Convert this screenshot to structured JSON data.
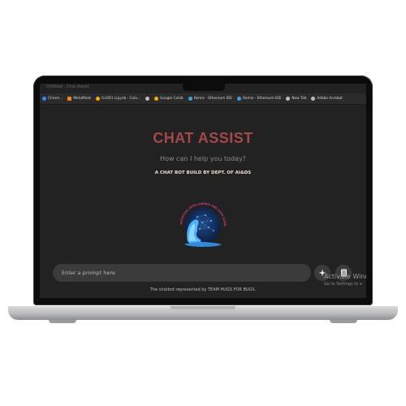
{
  "browser": {
    "window_title": "Untitled - Chat Assist",
    "bookmarks": [
      {
        "label": "Chrom...",
        "icon": "chrome-icon",
        "color": "#4285f4"
      },
      {
        "label": "MetaMask",
        "icon": "metamask-icon",
        "color": "#f6851b"
      },
      {
        "label": "fcc001 Lipynb - Cola...",
        "icon": "colab-icon",
        "color": "#f9ab00"
      },
      {
        "label": "",
        "icon": "globe-icon",
        "color": "#bdbdbd"
      },
      {
        "label": "Google Colab",
        "icon": "colab-icon",
        "color": "#f9ab00"
      },
      {
        "label": "Remix - Ethereum IDE",
        "icon": "remix-icon",
        "color": "#3aa3d9"
      },
      {
        "label": "Remix - Ethereum IDE",
        "icon": "remix-icon",
        "color": "#3aa3d9"
      },
      {
        "label": "New Tab",
        "icon": "globe-icon",
        "color": "#bdbdbd"
      },
      {
        "label": "Adobe Acrobat",
        "icon": "globe-icon",
        "color": "#bdbdbd"
      }
    ]
  },
  "chat": {
    "title": "CHAT ASSIST",
    "subtitle": "How can I help you today?",
    "tagline": "A CHAT BOT BUILD BY DEPT. OF AI&DS",
    "logo": {
      "ring_text": "ARTIFICIAL INTELLIGENCE AND DATA SCIENCE",
      "icon": "ai-head-logo-icon"
    },
    "prompt_placeholder": "Enter a prompt here",
    "buttons": [
      {
        "name": "image-upload-button",
        "icon": "sparkle-icon"
      },
      {
        "name": "document-button",
        "icon": "document-icon"
      }
    ],
    "footer": "The chatbot represented by TEAM HUGS FOR BUGS."
  },
  "os": {
    "watermark_title": "Activate Wind",
    "watermark_sub": "Go to Settings to a"
  },
  "colors": {
    "title": "#a64748",
    "background": "#222222",
    "input_bg": "#3b3b3b",
    "tagline": "#ece3c3"
  }
}
